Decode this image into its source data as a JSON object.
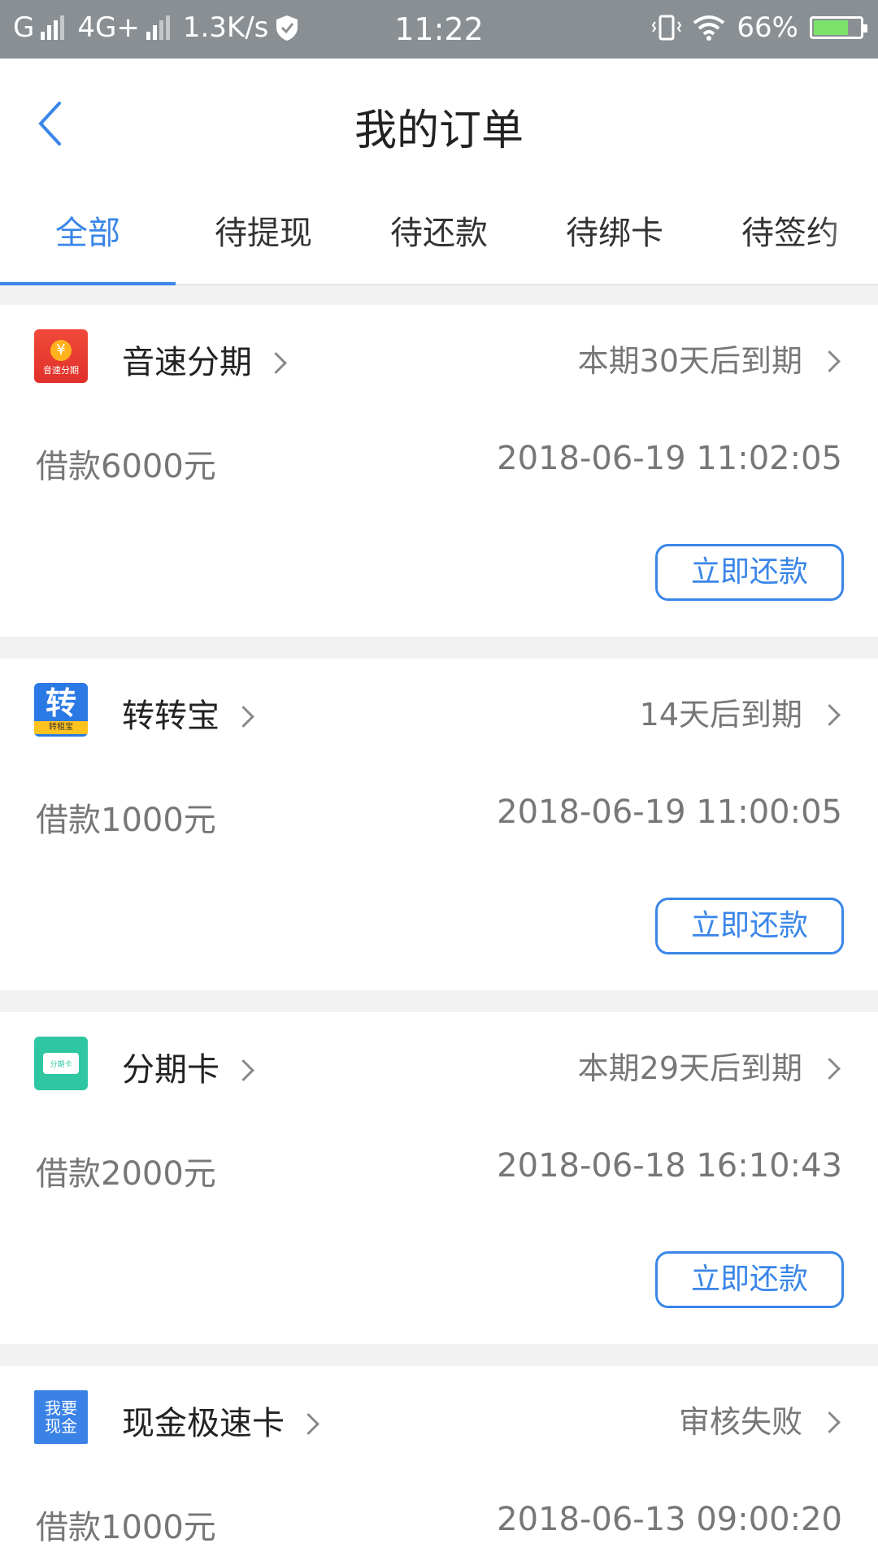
{
  "status_bar": {
    "network_left": "G",
    "network_mid": "4G+",
    "speed": "1.3K/s",
    "time": "11:22",
    "battery": "66%"
  },
  "nav": {
    "title": "我的订单"
  },
  "tabs": [
    "全部",
    "待提现",
    "待还款",
    "待绑卡",
    "待签约"
  ],
  "orders": [
    {
      "name": "音速分期",
      "logo_text": "音速分期",
      "logo_symbol": "¥",
      "status": "本期30天后到期",
      "amount": "借款6000元",
      "date": "2018-06-19 11:02:05",
      "action": "立即还款"
    },
    {
      "name": "转转宝",
      "logo_text": "转租宝",
      "logo_symbol": "转",
      "status": "14天后到期",
      "amount": "借款1000元",
      "date": "2018-06-19 11:00:05",
      "action": "立即还款"
    },
    {
      "name": "分期卡",
      "logo_text": "分期卡",
      "status": "本期29天后到期",
      "amount": "借款2000元",
      "date": "2018-06-18 16:10:43",
      "action": "立即还款"
    },
    {
      "name": "现金极速卡",
      "logo_text": "我要现金",
      "status": "审核失败",
      "amount": "借款1000元",
      "date": "2018-06-13 09:00:20"
    }
  ],
  "colors": {
    "accent": "#3a86e8",
    "statusbar": "#8a8f93"
  }
}
